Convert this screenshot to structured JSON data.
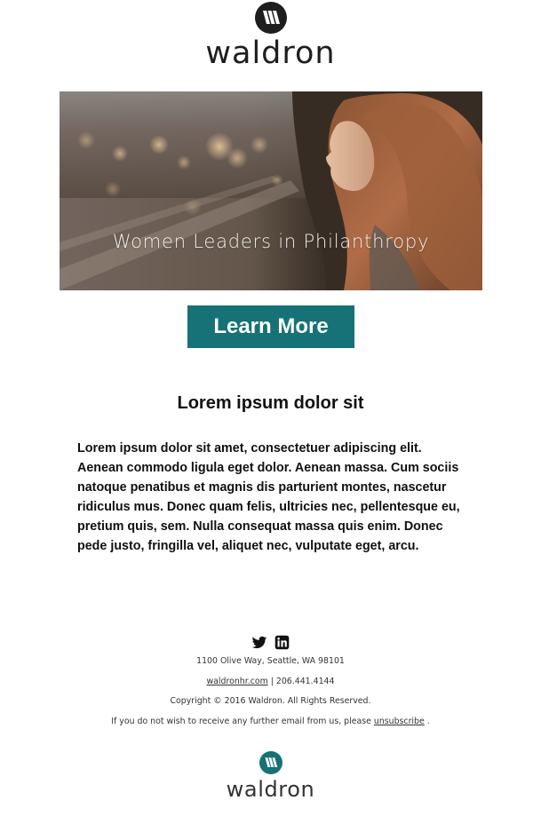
{
  "header": {
    "logo_word": "waldron",
    "logo_mark_color": "#1e1e1e"
  },
  "hero": {
    "caption": "Women Leaders in Philanthropy"
  },
  "cta": {
    "label": "Learn More",
    "color": "#167276"
  },
  "content": {
    "headline": "Lorem ipsum dolor sit",
    "body": "Lorem ipsum dolor sit amet, consectetuer adipiscing elit. Aenean commodo ligula eget dolor. Aenean massa. Cum sociis natoque penatibus et magnis dis parturient montes, nascetur ridiculus mus. Donec quam felis, ultricies nec, pellentesque eu, pretium quis, sem. Nulla consequat massa quis enim. Donec pede justo, fringilla vel, aliquet nec, vulputate eget, arcu."
  },
  "footer": {
    "social_icons": [
      "twitter-icon",
      "linkedin-icon"
    ],
    "address": "1100 Olive Way, Seattle, WA 98101",
    "website": "waldronhr.com",
    "phone_separator": " | ",
    "phone": "206.441.4144",
    "copyright": "Copyright © 2016 Waldron. All Rights Reserved.",
    "unsubscribe_prefix": "If you do not wish to receive any further email from us, please ",
    "unsubscribe_link": "unsubscribe",
    "unsubscribe_suffix": " .",
    "logo_word": "waldron",
    "logo_mark_color": "#167276"
  }
}
